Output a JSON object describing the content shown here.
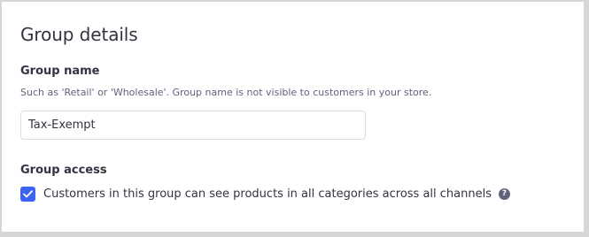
{
  "group_details": {
    "title": "Group details",
    "group_name": {
      "label": "Group name",
      "help": "Such as 'Retail' or 'Wholesale'. Group name is not visible to customers in your store.",
      "value": "Tax-Exempt"
    },
    "group_access": {
      "label": "Group access",
      "checkbox_label": "Customers in this group can see products in all categories across all channels",
      "checked": true,
      "help_icon": "question-circle-icon",
      "help_glyph": "?"
    }
  },
  "colors": {
    "accent": "#3c64f4",
    "text": "#313440",
    "muted": "#5e637a",
    "border": "#d9dce9"
  }
}
